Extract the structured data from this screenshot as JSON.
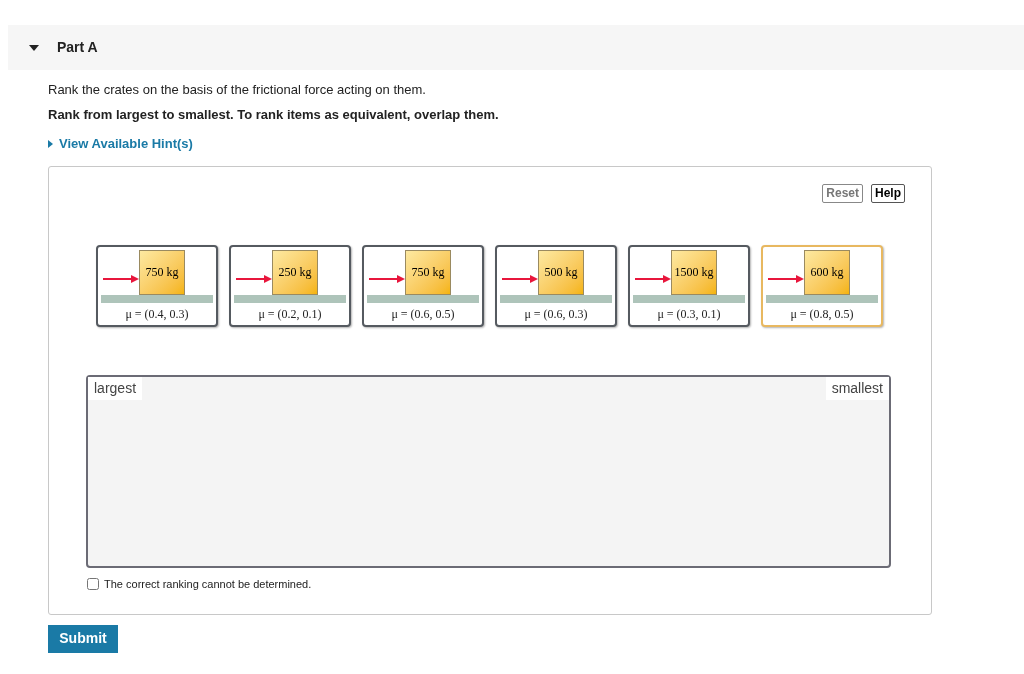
{
  "part": {
    "title": "Part A",
    "expanded": true
  },
  "prompt": "Rank the crates on the basis of the frictional force acting on them.",
  "instruction": "Rank from largest to smallest. To rank items as equivalent, overlap them.",
  "hints": {
    "label": "View Available Hint(s)",
    "expanded": false
  },
  "toolbar": [
    {
      "label": "Reset",
      "disabled": true
    },
    {
      "label": "Help",
      "disabled": false
    }
  ],
  "crates": [
    {
      "mass": "750 kg",
      "mu": "μ = (0.4, 0.3)",
      "selected": false
    },
    {
      "mass": "250 kg",
      "mu": "μ = (0.2, 0.1)",
      "selected": false
    },
    {
      "mass": "750 kg",
      "mu": "μ = (0.6, 0.5)",
      "selected": false
    },
    {
      "mass": "500 kg",
      "mu": "μ = (0.6, 0.3)",
      "selected": false
    },
    {
      "mass": "1500 kg",
      "mu": "μ = (0.3, 0.1)",
      "selected": false
    },
    {
      "mass": "600 kg",
      "mu": "μ = (0.8, 0.5)",
      "selected": true
    }
  ],
  "ranking": {
    "left": "largest",
    "right": "smallest"
  },
  "cannot_determine": {
    "label": "The correct ranking cannot be determined.",
    "checked": false
  },
  "submit": "Submit"
}
